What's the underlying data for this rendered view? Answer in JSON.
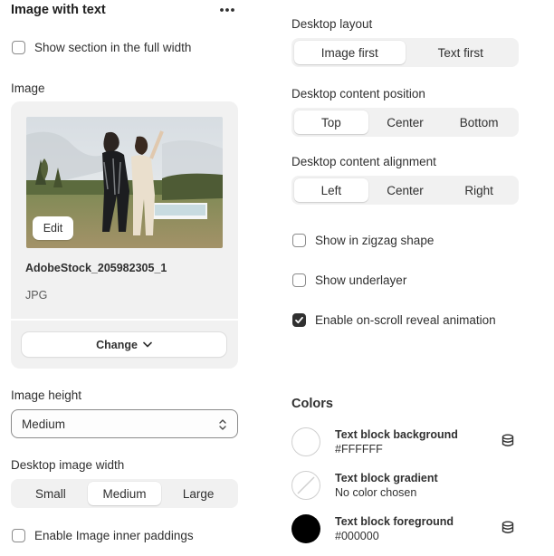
{
  "section": {
    "title": "Image with text",
    "full_width_label": "Show section in the full width",
    "full_width_checked": false
  },
  "image": {
    "heading": "Image",
    "edit_label": "Edit",
    "filename": "AdobeStock_205982305_1",
    "filetype": "JPG",
    "change_label": "Change"
  },
  "image_height": {
    "label": "Image height",
    "value": "Medium"
  },
  "desktop_image_width": {
    "label": "Desktop image width",
    "options": [
      "Small",
      "Medium",
      "Large"
    ],
    "selected": "Medium"
  },
  "inner_paddings": {
    "label": "Enable Image inner paddings",
    "checked": false
  },
  "desktop_layout": {
    "label": "Desktop layout",
    "options": [
      "Image first",
      "Text first"
    ],
    "selected": "Image first"
  },
  "desktop_content_position": {
    "label": "Desktop content position",
    "options": [
      "Top",
      "Center",
      "Bottom"
    ],
    "selected": "Top"
  },
  "desktop_content_alignment": {
    "label": "Desktop content alignment",
    "options": [
      "Left",
      "Center",
      "Right"
    ],
    "selected": "Left"
  },
  "toggles": {
    "zigzag": {
      "label": "Show in zigzag shape",
      "checked": false
    },
    "underlayer": {
      "label": "Show underlayer",
      "checked": false
    },
    "reveal": {
      "label": "Enable on-scroll reveal animation",
      "checked": true
    }
  },
  "colors": {
    "heading": "Colors",
    "items": [
      {
        "name": "Text block background",
        "value": "#FFFFFF",
        "swatch": "#ffffff",
        "icon": "database-icon"
      },
      {
        "name": "Text block gradient",
        "value": "No color chosen",
        "swatch": "none",
        "icon": ""
      },
      {
        "name": "Text block foreground",
        "value": "#000000",
        "swatch": "#000000",
        "icon": "database-icon"
      }
    ]
  },
  "icons": {
    "more": "more-horizontal-icon",
    "chevron": "chevron-down-icon",
    "select": "select-arrows-icon",
    "check": "checkmark-icon",
    "database": "database-icon"
  }
}
